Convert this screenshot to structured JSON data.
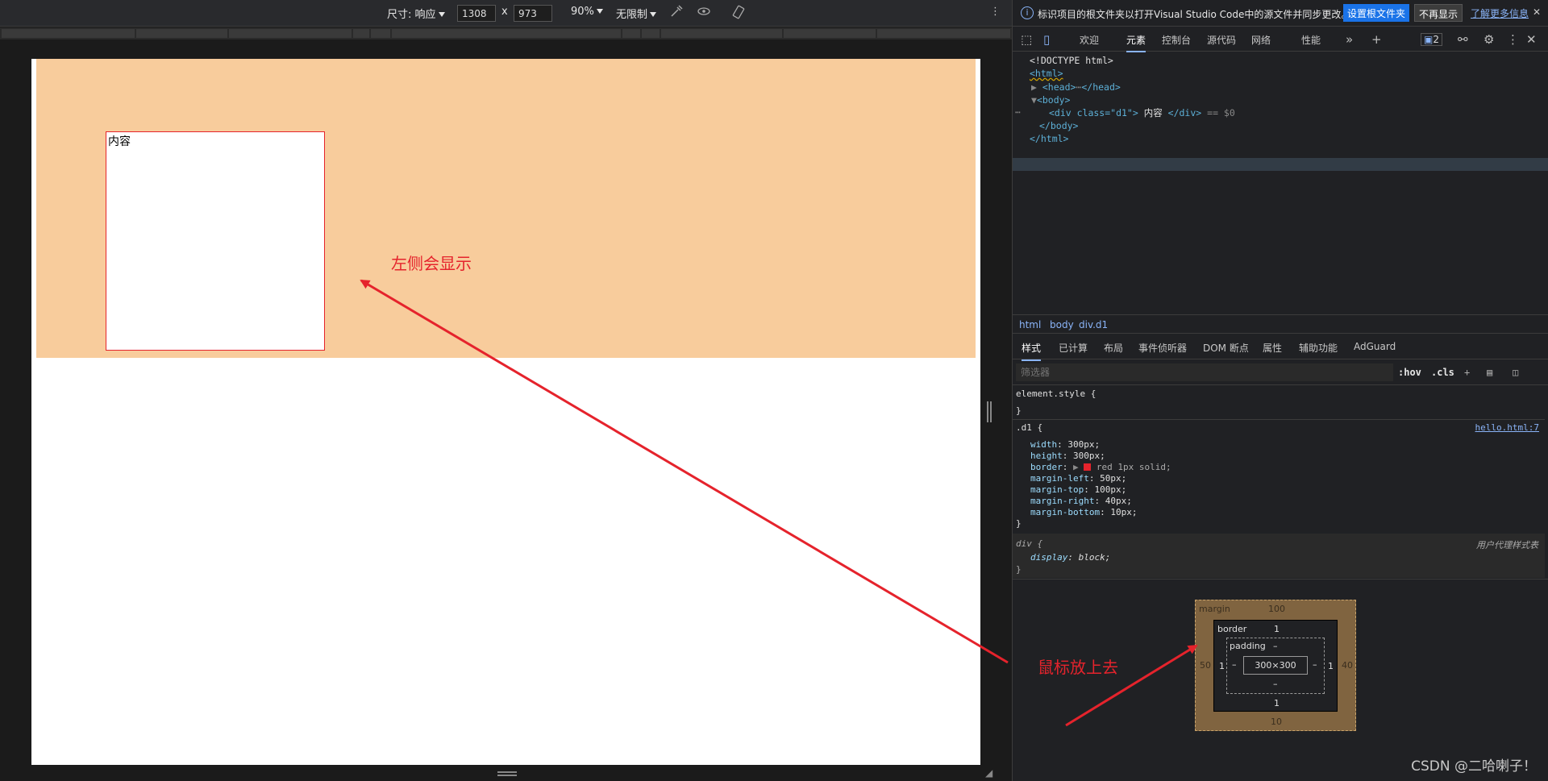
{
  "toolbar": {
    "size_label": "尺寸: 响应",
    "width": "1308",
    "times": "x",
    "height": "973",
    "zoom": "90%",
    "throttle": "无限制",
    "more": "⋮"
  },
  "viewport": {
    "div_text": "内容"
  },
  "annotations": {
    "left_show": "左侧会显示",
    "hover": "鼠标放上去"
  },
  "infobar": {
    "text": "标识项目的根文件夹以打开Visual Studio Code中的源文件并同步更改。",
    "set_root": "设置根文件夹",
    "dont_show": "不再显示",
    "learn_more": "了解更多信息"
  },
  "devtools_tabs": [
    "欢迎",
    "元素",
    "控制台",
    "源代码",
    "网络",
    "性能"
  ],
  "issues_count": "2",
  "dom": {
    "doctype": "<!DOCTYPE html>",
    "html_open": "<html>",
    "head": "<head>",
    "head_close": "</head>",
    "body_open": "<body>",
    "div_open": "<div class=\"d1\">",
    "div_text": "内容",
    "div_close": "</div>",
    "eq": "== $0",
    "body_close": "</body>",
    "html_close": "</html>"
  },
  "breadcrumbs": [
    "html",
    "body",
    "div.d1"
  ],
  "subtabs": [
    "样式",
    "已计算",
    "布局",
    "事件侦听器",
    "DOM 断点",
    "属性",
    "辅助功能",
    "AdGuard"
  ],
  "filter": {
    "placeholder": "筛选器",
    "hov": ":hov",
    "cls": ".cls"
  },
  "styles": {
    "element_style": "element.style {",
    "close": "}",
    "d1_selector": ".d1 {",
    "d1_source": "hello.html:7",
    "props": [
      {
        "name": "width",
        "value": "300px;"
      },
      {
        "name": "height",
        "value": "300px;"
      },
      {
        "name": "border",
        "value": "red 1px solid;"
      },
      {
        "name": "margin-left",
        "value": "50px;"
      },
      {
        "name": "margin-top",
        "value": "100px;"
      },
      {
        "name": "margin-right",
        "value": "40px;"
      },
      {
        "name": "margin-bottom",
        "value": "10px;"
      }
    ],
    "ua_selector": "div {",
    "ua_source": "用户代理样式表",
    "ua_prop": "display",
    "ua_value": "block;"
  },
  "boxmodel": {
    "margin_label": "margin",
    "margin_top": "100",
    "margin_left": "50",
    "margin_right": "40",
    "margin_bottom": "10",
    "border_label": "border",
    "border_top": "1",
    "border_left": "1",
    "border_right": "1",
    "border_bottom": "1",
    "padding_label": "padding",
    "padding_top": "–",
    "padding_left": "–",
    "padding_right": "–",
    "padding_bottom": "–",
    "content": "300×300"
  },
  "watermark": "CSDN @二哈喇子！",
  "colors": {
    "margin_highlight": "#f8cc9c",
    "border_red": "#e5232c",
    "link_blue": "#8ab4f8"
  }
}
